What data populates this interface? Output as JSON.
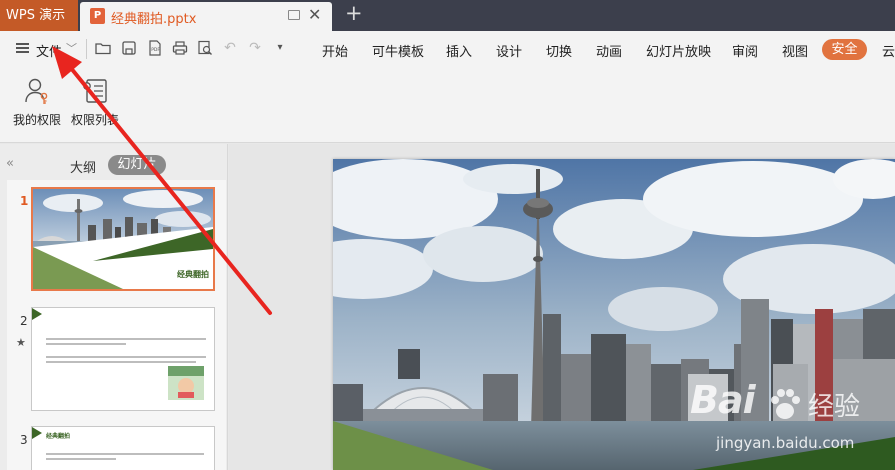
{
  "app": {
    "name": "WPS 演示"
  },
  "document_tab": {
    "name": "经典翻拍.pptx",
    "icon": "presentation-file-icon"
  },
  "menubar": {
    "file_label": "文件",
    "tabs": [
      "开始",
      "可牛模板",
      "插入",
      "设计",
      "切换",
      "动画",
      "幻灯片放映",
      "审阅",
      "视图"
    ],
    "security_label": "安全",
    "cloud_label": "云"
  },
  "ribbon": {
    "buttons": [
      {
        "label": "我的权限",
        "icon": "user-key-icon"
      },
      {
        "label": "权限列表",
        "icon": "permission-list-icon"
      }
    ]
  },
  "panel": {
    "tab_outline": "大纲",
    "tab_slides": "幻灯片",
    "slides": [
      {
        "number": "1",
        "title": "经典翻拍"
      },
      {
        "number": "2"
      },
      {
        "number": "3",
        "heading": "经典翻拍"
      }
    ]
  },
  "watermark": {
    "brand": "Bai",
    "brand_suffix": "经验",
    "url": "jingyan.baidu.com"
  },
  "colors": {
    "accent": "#c45a27",
    "tab_text": "#e05a22",
    "security": "#e1733f",
    "slide_green": "#5b8a3c",
    "arrow": "#e8251f"
  }
}
